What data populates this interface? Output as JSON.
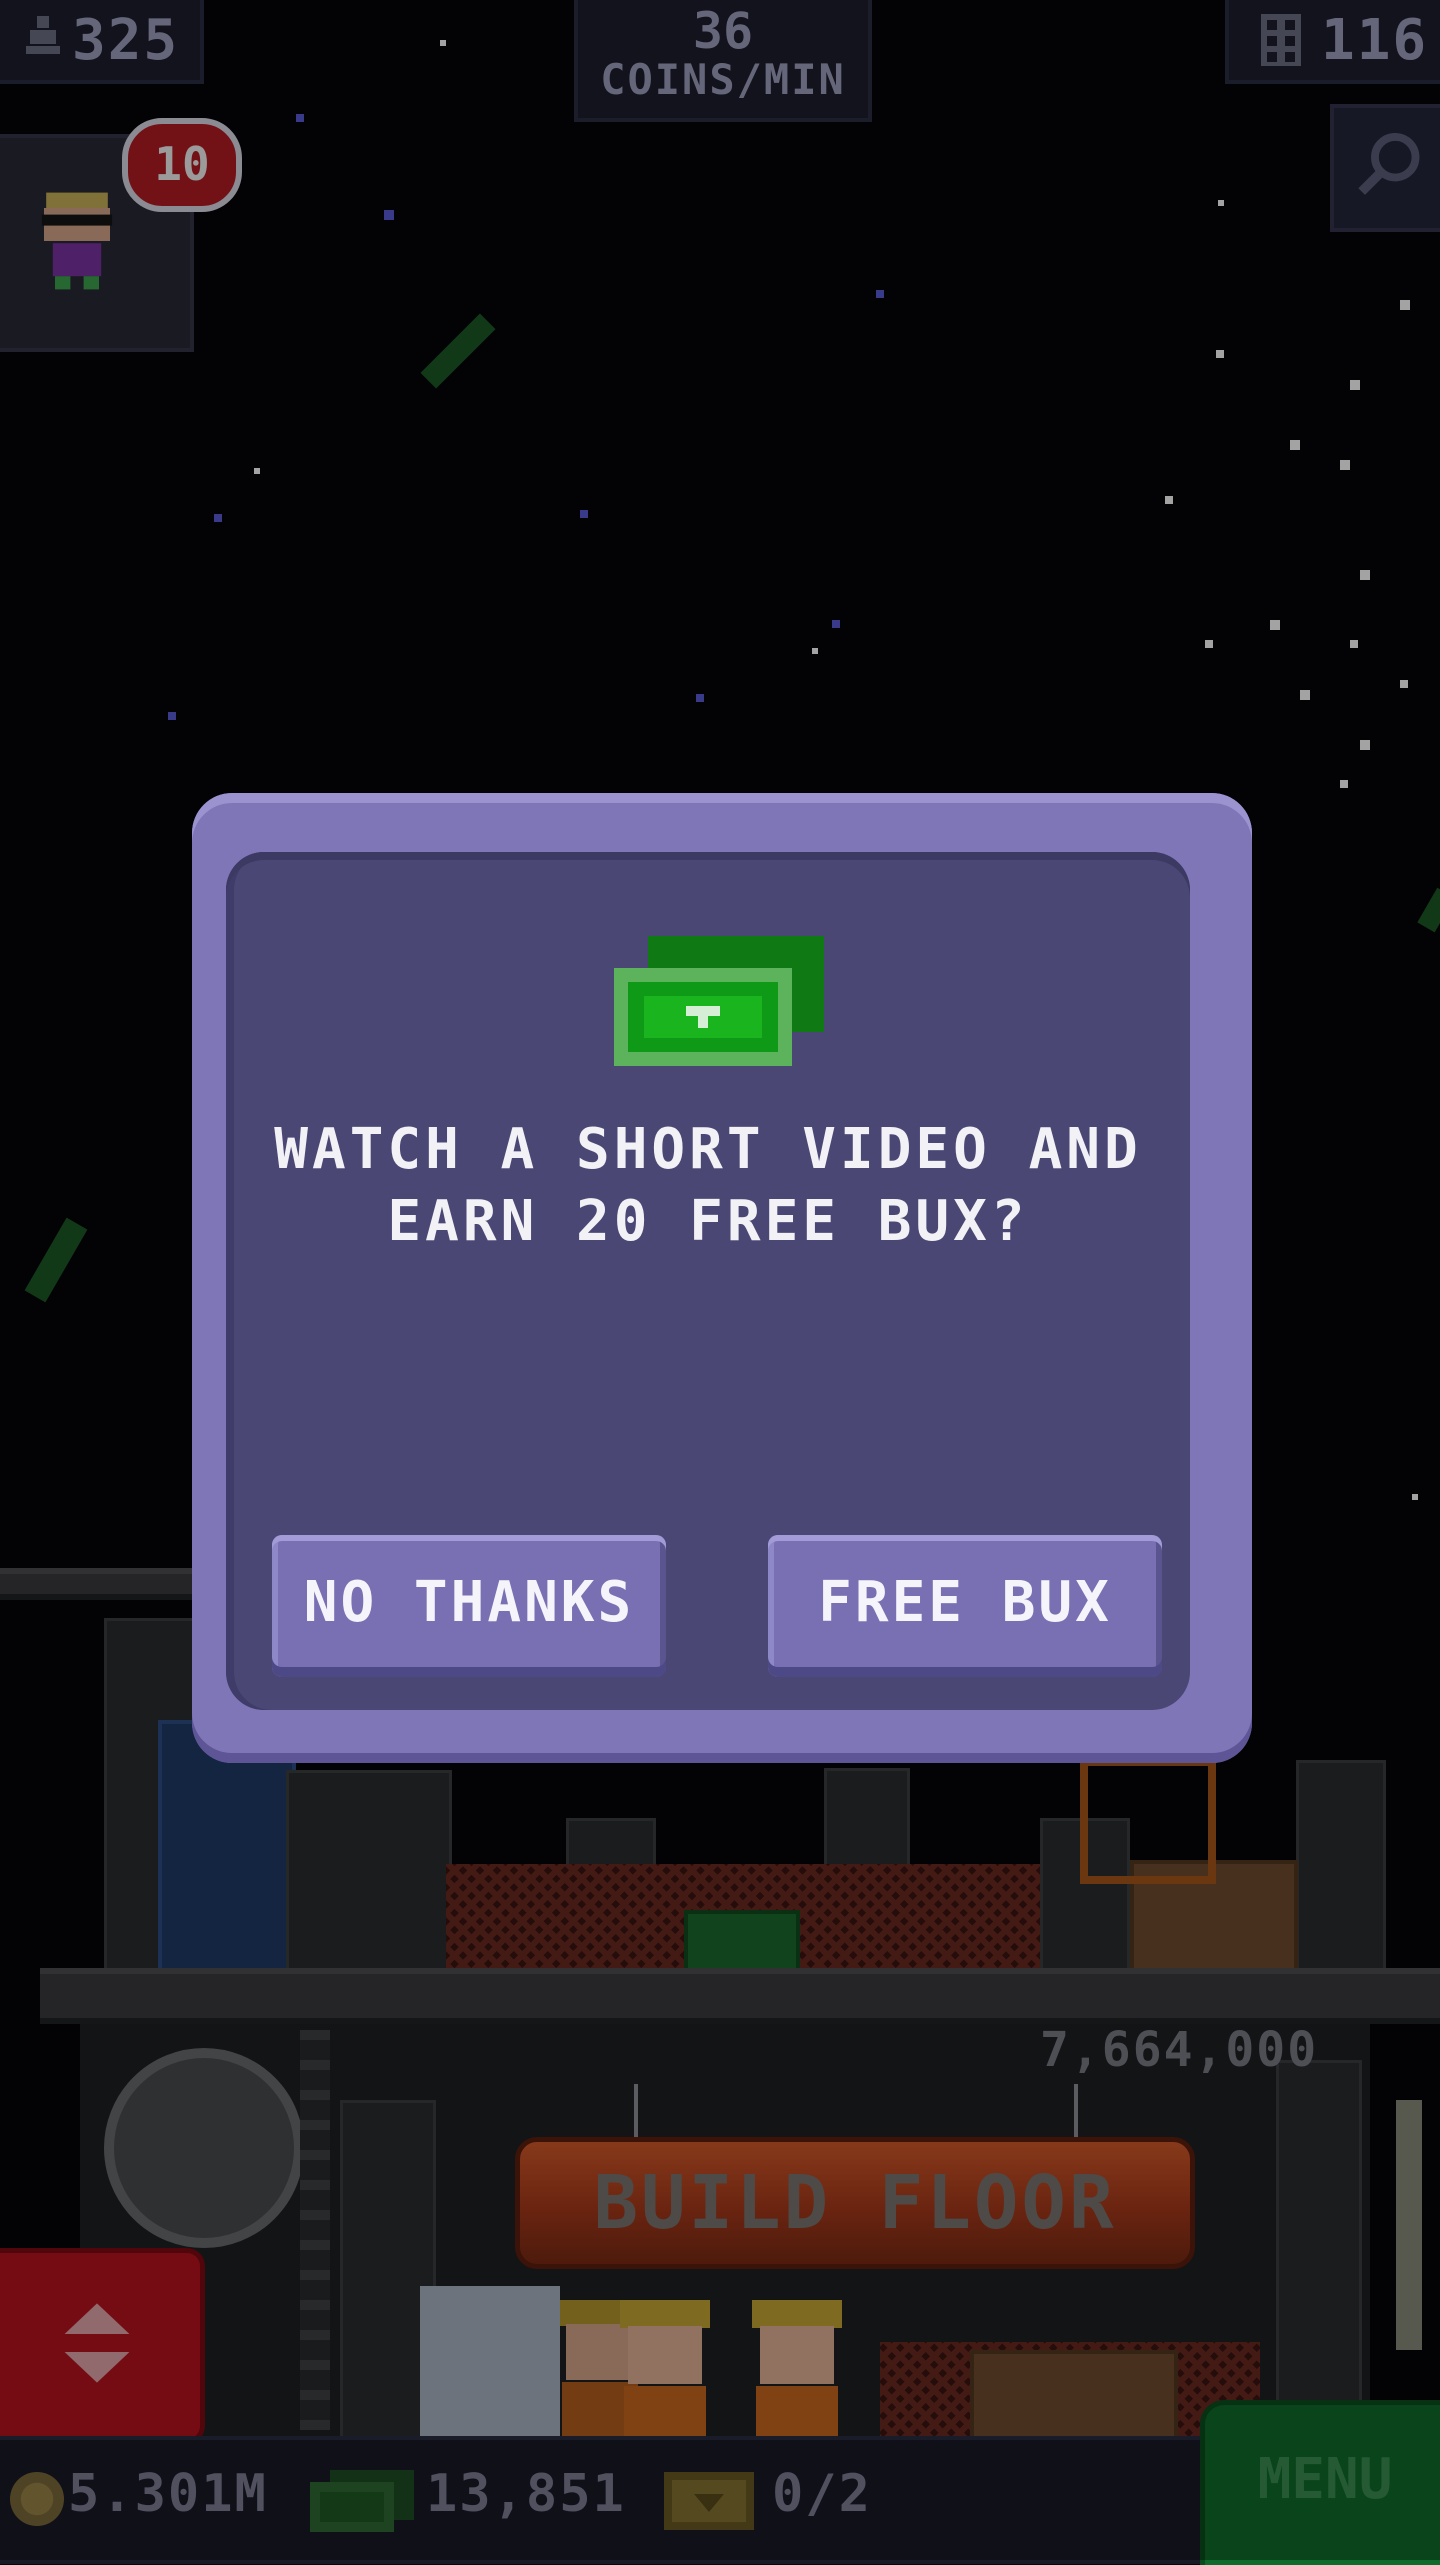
{
  "hud": {
    "population": "325",
    "coins_rate_value": "36",
    "coins_rate_unit": "COINS/MIN",
    "floors": "116",
    "notification_count": "10"
  },
  "tower": {
    "build_cost": "7,664,000",
    "build_label": "BUILD FLOOR"
  },
  "bottom_bar": {
    "coins": "5.301M",
    "bux": "13,851",
    "tickets": "0/2",
    "menu_label": "MENU"
  },
  "dialog": {
    "line1": "WATCH A SHORT VIDEO AND",
    "line2": "EARN 20 FREE BUX?",
    "no_label": "NO THANKS",
    "yes_label": "FREE BUX",
    "icon": "bux-bills-icon"
  },
  "icons": [
    "population-icon",
    "floors-icon",
    "search-icon",
    "elevator-arrows-icon",
    "coin-icon",
    "bux-icon",
    "ticket-icon"
  ],
  "colors": {
    "dialog_border": "#7f76b8",
    "dialog_fill": "#4a4775",
    "bux_green": "#2fb83b",
    "build_orange": "#c24a22",
    "menu_green": "#0f6b2b",
    "elevator_red": "#b7141f"
  }
}
